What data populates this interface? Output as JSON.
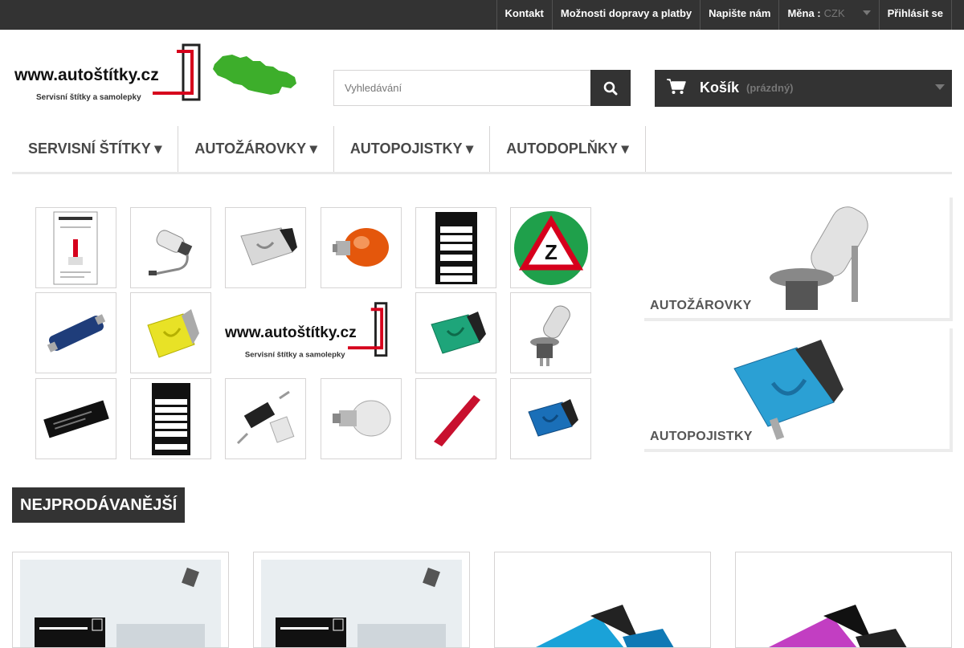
{
  "topnav": {
    "contact": "Kontakt",
    "shipping": "Možnosti dopravy a platby",
    "write_us": "Napište nám",
    "currency_label": "Měna :",
    "currency_value": "CZK",
    "login": "Přihlásit se"
  },
  "logo": {
    "site": "www.autoštítky.cz",
    "tagline": "Servisní štítky a samolepky"
  },
  "search": {
    "placeholder": "Vyhledávání"
  },
  "cart": {
    "label": "Košík",
    "status": "(prázdný)"
  },
  "menu": [
    {
      "label": "SERVISNÍ ŠTÍTKY ▾"
    },
    {
      "label": "AUTOŽÁROVKY ▾"
    },
    {
      "label": "AUTOPOJISTKY ▾"
    },
    {
      "label": "AUTODOPLŇKY ▾"
    }
  ],
  "grid_logo": {
    "site": "www.autoštítky.cz",
    "tagline": "Servisní štítky a samolepky"
  },
  "banners": [
    {
      "label": "AUTOŽÁROVKY"
    },
    {
      "label": "AUTOPOJISTKY"
    }
  ],
  "bestsellers": {
    "title": "NEJPRODÁVANĚJŠÍ"
  },
  "products": [
    {
      "image": "service-sticker"
    },
    {
      "image": "service-sticker"
    },
    {
      "image": "blue-fuse"
    },
    {
      "image": "pink-fuse"
    }
  ],
  "colors": {
    "dark": "#333333",
    "accent_red": "#d6001c",
    "green": "#3dae2b"
  }
}
